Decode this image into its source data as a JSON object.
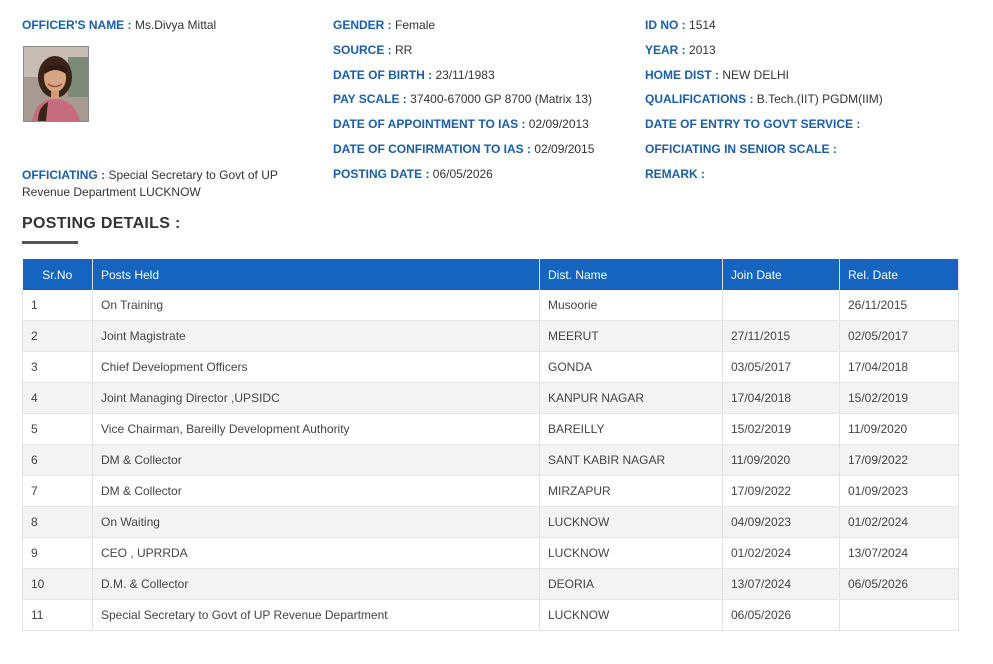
{
  "officer": {
    "name_label": "OFFICER'S NAME :",
    "name_value": "Ms.Divya Mittal",
    "officiating_label": "OFFICIATING :",
    "officiating_value": "Special Secretary to Govt of UP Revenue Department LUCKNOW"
  },
  "mid_col": [
    {
      "label": "GENDER :",
      "value": "Female"
    },
    {
      "label": "SOURCE :",
      "value": "RR"
    },
    {
      "label": "DATE OF BIRTH :",
      "value": "23/11/1983"
    },
    {
      "label": "PAY SCALE :",
      "value": "37400-67000 GP 8700 (Matrix 13)"
    },
    {
      "label": "DATE OF APPOINTMENT TO IAS :",
      "value": "02/09/2013"
    },
    {
      "label": "DATE OF CONFIRMATION TO IAS :",
      "value": "02/09/2015"
    },
    {
      "label": "POSTING DATE :",
      "value": "06/05/2026"
    }
  ],
  "right_col": [
    {
      "label": "ID NO :",
      "value": "1514"
    },
    {
      "label": "YEAR :",
      "value": "2013"
    },
    {
      "label": "HOME DIST :",
      "value": "NEW DELHI"
    },
    {
      "label": "QUALIFICATIONS :",
      "value": "B.Tech.(IIT) PGDM(IIM)"
    },
    {
      "label": "DATE OF ENTRY TO GOVT SERVICE :",
      "value": ""
    },
    {
      "label": "OFFICIATING IN SENIOR SCALE :",
      "value": ""
    },
    {
      "label": "REMARK :",
      "value": ""
    }
  ],
  "section": {
    "title": "POSTING DETAILS :"
  },
  "table": {
    "headers": [
      "Sr.No",
      "Posts Held",
      "Dist. Name",
      "Join Date",
      "Rel. Date"
    ],
    "rows": [
      [
        "1",
        "On Training",
        "Musoorie",
        "",
        "26/11/2015"
      ],
      [
        "2",
        "Joint Magistrate",
        "MEERUT",
        "27/11/2015",
        "02/05/2017"
      ],
      [
        "3",
        "Chief Development Officers",
        "GONDA",
        "03/05/2017",
        "17/04/2018"
      ],
      [
        "4",
        "Joint Managing Director ,UPSIDC",
        "KANPUR NAGAR",
        "17/04/2018",
        "15/02/2019"
      ],
      [
        "5",
        "Vice Chairman, Bareilly Development Authority",
        "BAREILLY",
        "15/02/2019",
        "11/09/2020"
      ],
      [
        "6",
        "DM & Collector",
        "SANT KABIR NAGAR",
        "11/09/2020",
        "17/09/2022"
      ],
      [
        "7",
        "DM & Collector",
        "MIRZAPUR",
        "17/09/2022",
        "01/09/2023"
      ],
      [
        "8",
        "On Waiting",
        "LUCKNOW",
        "04/09/2023",
        "01/02/2024"
      ],
      [
        "9",
        "CEO , UPRRDA",
        "LUCKNOW",
        "01/02/2024",
        "13/07/2024"
      ],
      [
        "10",
        "D.M. & Collector",
        "DEORIA",
        "13/07/2024",
        "06/05/2026"
      ],
      [
        "11",
        "Special Secretary to Govt of UP Revenue Department",
        "LUCKNOW",
        "06/05/2026",
        ""
      ]
    ]
  },
  "colors": {
    "label": "#1a5ea8",
    "header_bg": "#1565c0",
    "row_alt": "#f3f3f3"
  }
}
